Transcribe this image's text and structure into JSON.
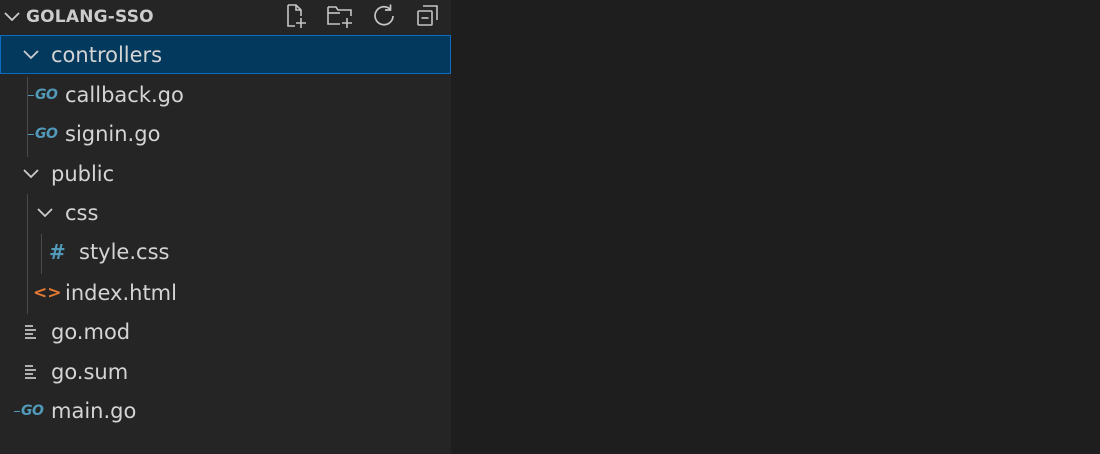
{
  "explorer": {
    "project_title": "GOLANG-SSO",
    "actions": [
      {
        "name": "new-file-icon"
      },
      {
        "name": "new-folder-icon"
      },
      {
        "name": "refresh-icon"
      },
      {
        "name": "collapse-all-icon"
      }
    ],
    "tree": [
      {
        "label": "controllers",
        "type": "folder",
        "expanded": true,
        "selected": true
      },
      {
        "label": "callback.go",
        "type": "go"
      },
      {
        "label": "signin.go",
        "type": "go"
      },
      {
        "label": "public",
        "type": "folder",
        "expanded": true
      },
      {
        "label": "css",
        "type": "folder",
        "expanded": true
      },
      {
        "label": "style.css",
        "type": "css"
      },
      {
        "label": "index.html",
        "type": "html"
      },
      {
        "label": "go.mod",
        "type": "text"
      },
      {
        "label": "go.sum",
        "type": "text"
      },
      {
        "label": "main.go",
        "type": "go"
      }
    ],
    "icon_glyphs": {
      "go": "GO",
      "css": "#",
      "html": "<>"
    }
  },
  "colors": {
    "sidebar_bg": "#252526",
    "editor_bg": "#1e1e1e",
    "selection_bg": "#04395e",
    "selection_border": "#0b6cc2",
    "text": "#d4d4d4",
    "go_blue": "#519aba",
    "html_orange": "#e37933"
  }
}
